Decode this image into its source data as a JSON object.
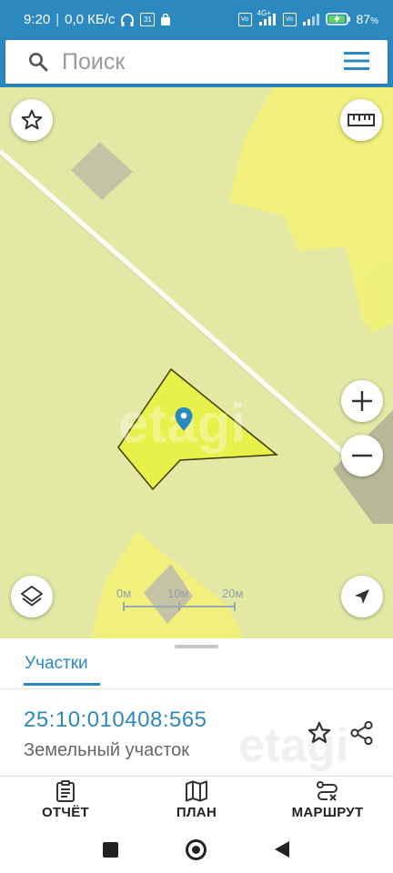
{
  "status_bar": {
    "time": "9:20",
    "speed": "0,0 КБ/с",
    "calendar_day": "31",
    "network_label": "4G+",
    "battery": "87",
    "battery_unit": "%"
  },
  "search": {
    "placeholder": "Поиск"
  },
  "map": {
    "watermark": "etagi",
    "scale": {
      "labels": [
        "0м",
        "10м",
        "20м"
      ]
    }
  },
  "sheet": {
    "tab_label": "Участки",
    "cadastral_number": "25:10:010408:565",
    "land_type": "Земельный участок",
    "watermark": "etagi"
  },
  "actions": {
    "report": "ОТЧЁТ",
    "plan": "ПЛАН",
    "route": "МАРШРУТ"
  },
  "colors": {
    "accent": "#2c89bf",
    "map_bg": "#e3e9a4",
    "parcel_yellow": "#f2f07c",
    "selected_parcel": "#e8f04a",
    "building_gray": "#c4c3a6"
  }
}
